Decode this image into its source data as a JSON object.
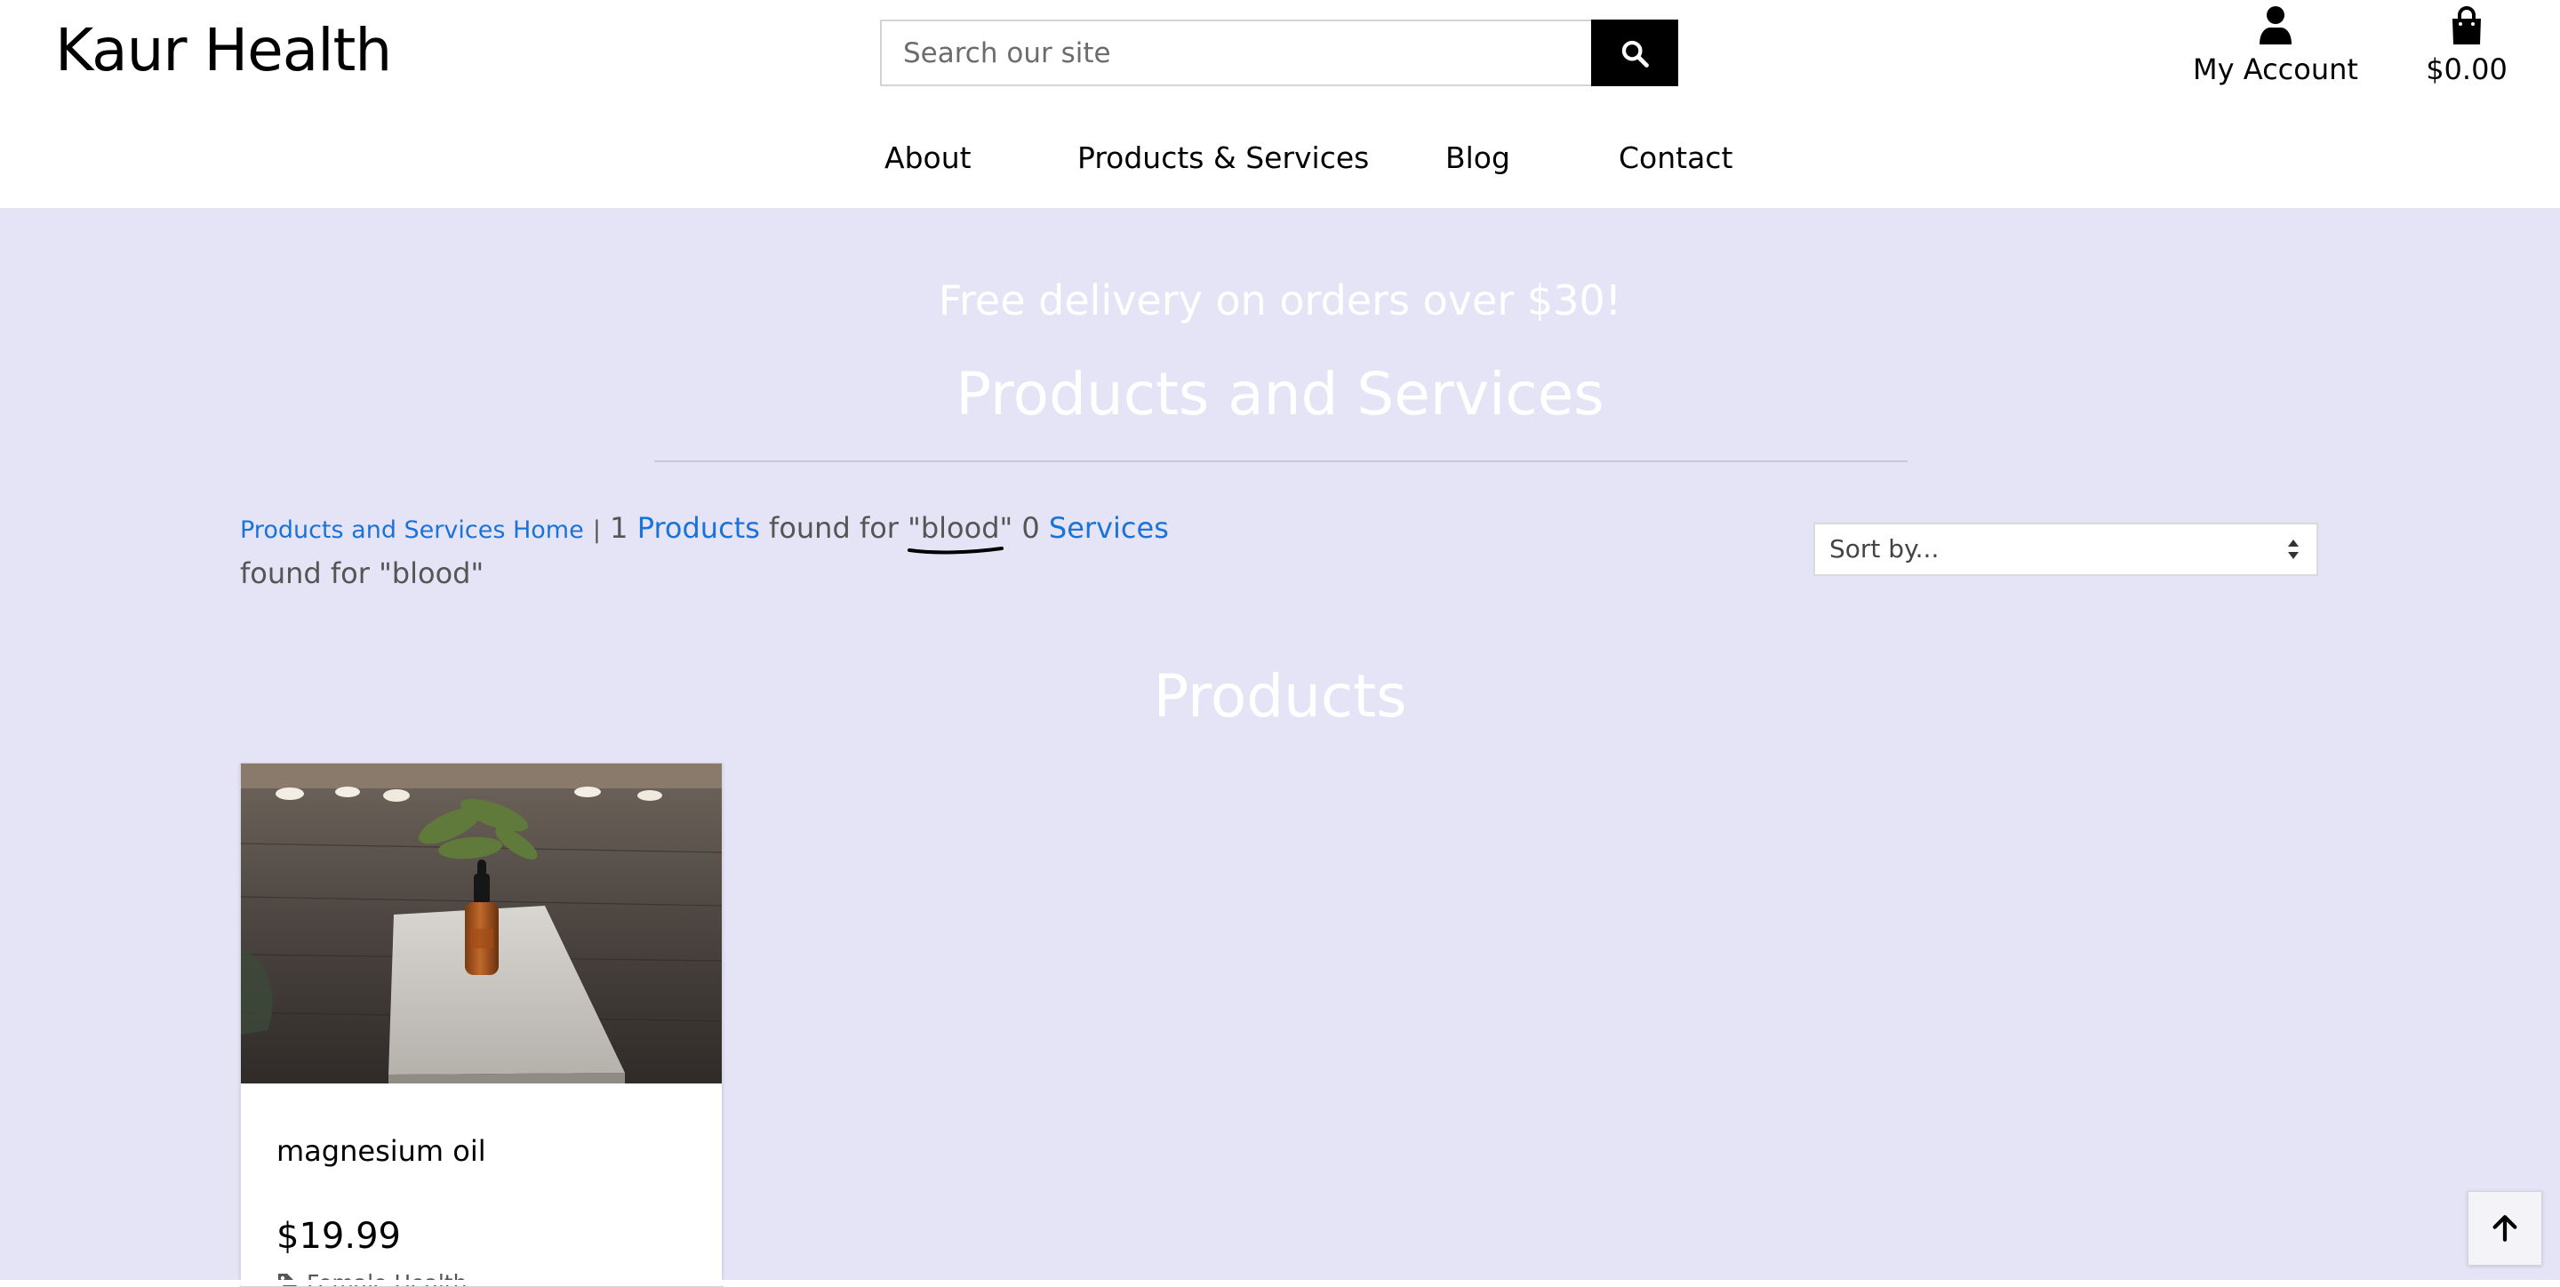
{
  "header": {
    "brand": "Kaur Health",
    "search": {
      "placeholder": "Search our site",
      "value": ""
    },
    "account_label": "My Account",
    "cart_total": "$0.00"
  },
  "nav": {
    "items": [
      {
        "label": "About"
      },
      {
        "label": "Products & Services"
      },
      {
        "label": "Blog"
      },
      {
        "label": "Contact"
      }
    ]
  },
  "banner": {
    "text": "Free delivery on orders over $30!"
  },
  "page": {
    "title": "Products and Services",
    "results": {
      "home_link": "Products and Services Home",
      "separator": "|",
      "product_count": "1",
      "products_link": "Products",
      "found_for": "found for",
      "term": "\"blood\"",
      "service_count": "0",
      "services_link": "Services"
    },
    "sort": {
      "selected": "Sort by..."
    },
    "section_title": "Products"
  },
  "products": [
    {
      "name": "magnesium oil",
      "price": "$19.99",
      "category": "Female Health"
    }
  ],
  "icons": {
    "search": "search-icon",
    "account": "user-icon",
    "cart": "shopping-bag-icon",
    "sort": "sort-arrows-icon",
    "category": "tag-icon",
    "back_to_top": "arrow-up-icon"
  },
  "colors": {
    "page_background": "#e4e4f6",
    "link": "#1a73d8",
    "heading": "#ffffff",
    "search_button": "#000000"
  }
}
